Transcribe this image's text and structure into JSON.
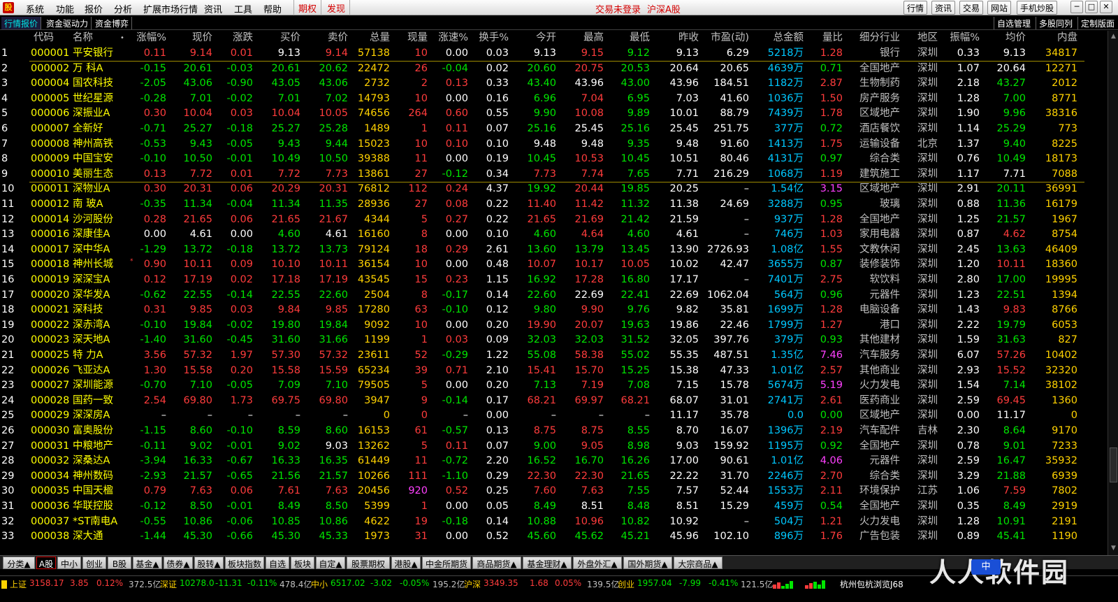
{
  "menubar": {
    "items": [
      "系统",
      "功能",
      "报价",
      "分析",
      "扩展市场行情",
      "资讯",
      "工具",
      "帮助"
    ],
    "red_tabs": [
      "期权",
      "发现"
    ],
    "login_status": "交易未登录",
    "market": "沪深A股",
    "right_buttons": [
      "行情",
      "资讯",
      "交易",
      "网站",
      "手机炒股"
    ]
  },
  "subbar": {
    "tabs": [
      "行情报价",
      "资金驱动力",
      "资金博弈"
    ],
    "right_buttons": [
      "自选管理",
      "多股同列",
      "定制版面"
    ]
  },
  "table": {
    "headers": [
      "代码",
      "名称",
      "涨幅%",
      "现价",
      "涨跌",
      "买价",
      "卖价",
      "总量",
      "现量",
      "涨速%",
      "换手%",
      "今开",
      "最高",
      "最低",
      "昨收",
      "市盈(动)",
      "总金额",
      "量比",
      "细分行业",
      "地区",
      "振幅%",
      "均价",
      "内盘"
    ],
    "rows": [
      [
        "1",
        "000001",
        "平安银行",
        "0.11",
        "9.14",
        "0.01",
        "9.13",
        "9.14",
        "57138",
        "10",
        "0.00",
        "0.03",
        "9.13",
        "9.15",
        "9.12",
        "9.13",
        "6.29",
        "5218万",
        "1.28",
        "银行",
        "深圳",
        "0.33",
        "9.13",
        "34817"
      ],
      [
        "2",
        "000002",
        "万 科A",
        "-0.15",
        "20.61",
        "-0.03",
        "20.61",
        "20.62",
        "22472",
        "26",
        "-0.04",
        "0.02",
        "20.60",
        "20.75",
        "20.53",
        "20.64",
        "20.65",
        "4639万",
        "0.71",
        "全国地产",
        "深圳",
        "1.07",
        "20.64",
        "12271"
      ],
      [
        "3",
        "000004",
        "国农科技",
        "-2.05",
        "43.06",
        "-0.90",
        "43.05",
        "43.06",
        "2732",
        "2",
        "0.13",
        "0.33",
        "43.40",
        "43.96",
        "43.00",
        "43.96",
        "184.51",
        "1182万",
        "2.87",
        "生物制药",
        "深圳",
        "2.18",
        "43.27",
        "2012"
      ],
      [
        "4",
        "000005",
        "世纪星源",
        "-0.28",
        "7.01",
        "-0.02",
        "7.01",
        "7.02",
        "14793",
        "10",
        "0.00",
        "0.16",
        "6.96",
        "7.04",
        "6.95",
        "7.03",
        "41.60",
        "1036万",
        "1.50",
        "房产服务",
        "深圳",
        "1.28",
        "7.00",
        "8771"
      ],
      [
        "5",
        "000006",
        "深振业A",
        "0.30",
        "10.04",
        "0.03",
        "10.04",
        "10.05",
        "74656",
        "264",
        "0.60",
        "0.55",
        "9.90",
        "10.08",
        "9.89",
        "10.01",
        "88.79",
        "7439万",
        "1.78",
        "区域地产",
        "深圳",
        "1.90",
        "9.96",
        "38316"
      ],
      [
        "6",
        "000007",
        "全新好",
        "-0.71",
        "25.27",
        "-0.18",
        "25.27",
        "25.28",
        "1489",
        "1",
        "0.11",
        "0.07",
        "25.16",
        "25.45",
        "25.16",
        "25.45",
        "251.75",
        "377万",
        "0.72",
        "酒店餐饮",
        "深圳",
        "1.14",
        "25.29",
        "773"
      ],
      [
        "7",
        "000008",
        "神州高铁",
        "-0.53",
        "9.43",
        "-0.05",
        "9.43",
        "9.44",
        "15023",
        "10",
        "0.10",
        "0.10",
        "9.48",
        "9.48",
        "9.35",
        "9.48",
        "91.60",
        "1413万",
        "1.75",
        "运输设备",
        "北京",
        "1.37",
        "9.40",
        "8225"
      ],
      [
        "8",
        "000009",
        "中国宝安",
        "-0.10",
        "10.50",
        "-0.01",
        "10.49",
        "10.50",
        "39388",
        "11",
        "0.00",
        "0.19",
        "10.45",
        "10.53",
        "10.45",
        "10.51",
        "80.46",
        "4131万",
        "0.97",
        "综合类",
        "深圳",
        "0.76",
        "10.49",
        "18173"
      ],
      [
        "9",
        "000010",
        "美丽生态",
        "0.13",
        "7.72",
        "0.01",
        "7.72",
        "7.73",
        "13861",
        "27",
        "-0.12",
        "0.34",
        "7.73",
        "7.74",
        "7.65",
        "7.71",
        "216.29",
        "1068万",
        "1.19",
        "建筑施工",
        "深圳",
        "1.17",
        "7.71",
        "7088"
      ],
      [
        "10",
        "000011",
        "深物业A",
        "0.30",
        "20.31",
        "0.06",
        "20.29",
        "20.31",
        "76812",
        "112",
        "0.24",
        "4.37",
        "19.92",
        "20.44",
        "19.85",
        "20.25",
        "–",
        "1.54亿",
        "3.15",
        "区域地产",
        "深圳",
        "2.91",
        "20.11",
        "36991"
      ],
      [
        "11",
        "000012",
        "南 玻A",
        "-0.35",
        "11.34",
        "-0.04",
        "11.34",
        "11.35",
        "28936",
        "27",
        "0.08",
        "0.22",
        "11.40",
        "11.42",
        "11.32",
        "11.38",
        "24.69",
        "3288万",
        "0.95",
        "玻璃",
        "深圳",
        "0.88",
        "11.36",
        "16179"
      ],
      [
        "12",
        "000014",
        "沙河股份",
        "0.28",
        "21.65",
        "0.06",
        "21.65",
        "21.67",
        "4344",
        "5",
        "0.27",
        "0.22",
        "21.65",
        "21.69",
        "21.42",
        "21.59",
        "–",
        "937万",
        "1.28",
        "全国地产",
        "深圳",
        "1.25",
        "21.57",
        "1967"
      ],
      [
        "13",
        "000016",
        "深康佳A",
        "0.00",
        "4.61",
        "0.00",
        "4.60",
        "4.61",
        "16160",
        "8",
        "0.00",
        "0.10",
        "4.60",
        "4.64",
        "4.60",
        "4.61",
        "–",
        "746万",
        "1.03",
        "家用电器",
        "深圳",
        "0.87",
        "4.62",
        "8754"
      ],
      [
        "14",
        "000017",
        "深中华A",
        "-1.29",
        "13.72",
        "-0.18",
        "13.72",
        "13.73",
        "79124",
        "18",
        "0.29",
        "2.61",
        "13.60",
        "13.79",
        "13.45",
        "13.90",
        "2726.93",
        "1.08亿",
        "1.55",
        "文教休闲",
        "深圳",
        "2.45",
        "13.63",
        "46409"
      ],
      [
        "15",
        "000018",
        "神州长城",
        "0.90",
        "10.11",
        "0.09",
        "10.10",
        "10.11",
        "36154",
        "10",
        "0.00",
        "0.48",
        "10.07",
        "10.17",
        "10.05",
        "10.02",
        "42.47",
        "3655万",
        "0.87",
        "装修装饰",
        "深圳",
        "1.20",
        "10.11",
        "18360"
      ],
      [
        "16",
        "000019",
        "深深宝A",
        "0.12",
        "17.19",
        "0.02",
        "17.18",
        "17.19",
        "43545",
        "15",
        "0.23",
        "1.15",
        "16.92",
        "17.28",
        "16.80",
        "17.17",
        "–",
        "7401万",
        "2.75",
        "软饮料",
        "深圳",
        "2.80",
        "17.00",
        "19995"
      ],
      [
        "17",
        "000020",
        "深华发A",
        "-0.62",
        "22.55",
        "-0.14",
        "22.55",
        "22.60",
        "2504",
        "8",
        "-0.17",
        "0.14",
        "22.60",
        "22.69",
        "22.41",
        "22.69",
        "1062.04",
        "564万",
        "0.96",
        "元器件",
        "深圳",
        "1.23",
        "22.51",
        "1394"
      ],
      [
        "18",
        "000021",
        "深科技",
        "0.31",
        "9.85",
        "0.03",
        "9.84",
        "9.85",
        "17280",
        "63",
        "-0.10",
        "0.12",
        "9.80",
        "9.90",
        "9.76",
        "9.82",
        "35.81",
        "1699万",
        "1.28",
        "电脑设备",
        "深圳",
        "1.43",
        "9.83",
        "8766"
      ],
      [
        "19",
        "000022",
        "深赤湾A",
        "-0.10",
        "19.84",
        "-0.02",
        "19.80",
        "19.84",
        "9092",
        "10",
        "0.00",
        "0.20",
        "19.90",
        "20.07",
        "19.63",
        "19.86",
        "22.46",
        "1799万",
        "1.27",
        "港口",
        "深圳",
        "2.22",
        "19.79",
        "6053"
      ],
      [
        "20",
        "000023",
        "深天地A",
        "-1.40",
        "31.60",
        "-0.45",
        "31.60",
        "31.66",
        "1199",
        "1",
        "0.03",
        "0.09",
        "32.03",
        "32.03",
        "31.52",
        "32.05",
        "397.76",
        "379万",
        "0.93",
        "其他建材",
        "深圳",
        "1.59",
        "31.63",
        "827"
      ],
      [
        "21",
        "000025",
        "特 力A",
        "3.56",
        "57.32",
        "1.97",
        "57.30",
        "57.32",
        "23611",
        "52",
        "-0.29",
        "1.22",
        "55.08",
        "58.38",
        "55.02",
        "55.35",
        "487.51",
        "1.35亿",
        "7.46",
        "汽车服务",
        "深圳",
        "6.07",
        "57.26",
        "10402"
      ],
      [
        "22",
        "000026",
        "飞亚达A",
        "1.30",
        "15.58",
        "0.20",
        "15.58",
        "15.59",
        "65234",
        "39",
        "0.71",
        "2.10",
        "15.41",
        "15.70",
        "15.25",
        "15.38",
        "47.33",
        "1.01亿",
        "2.57",
        "其他商业",
        "深圳",
        "2.93",
        "15.52",
        "32320"
      ],
      [
        "23",
        "000027",
        "深圳能源",
        "-0.70",
        "7.10",
        "-0.05",
        "7.09",
        "7.10",
        "79505",
        "5",
        "0.00",
        "0.20",
        "7.13",
        "7.19",
        "7.08",
        "7.15",
        "15.78",
        "5674万",
        "5.19",
        "火力发电",
        "深圳",
        "1.54",
        "7.14",
        "38102"
      ],
      [
        "24",
        "000028",
        "国药一致",
        "2.54",
        "69.80",
        "1.73",
        "69.75",
        "69.80",
        "3947",
        "9",
        "-0.14",
        "0.17",
        "68.21",
        "69.97",
        "68.21",
        "68.07",
        "31.01",
        "2741万",
        "2.61",
        "医药商业",
        "深圳",
        "2.59",
        "69.45",
        "1360"
      ],
      [
        "25",
        "000029",
        "深深房A",
        "–",
        "–",
        "–",
        "–",
        "–",
        "0",
        "0",
        "–",
        "0.00",
        "–",
        "–",
        "–",
        "11.17",
        "35.78",
        "0.0",
        "0.00",
        "区域地产",
        "深圳",
        "0.00",
        "11.17",
        "0"
      ],
      [
        "26",
        "000030",
        "富奥股份",
        "-1.15",
        "8.60",
        "-0.10",
        "8.59",
        "8.60",
        "16153",
        "61",
        "-0.57",
        "0.13",
        "8.75",
        "8.75",
        "8.55",
        "8.70",
        "16.07",
        "1396万",
        "2.19",
        "汽车配件",
        "吉林",
        "2.30",
        "8.64",
        "9170"
      ],
      [
        "27",
        "000031",
        "中粮地产",
        "-0.11",
        "9.02",
        "-0.01",
        "9.02",
        "9.03",
        "13262",
        "5",
        "0.11",
        "0.07",
        "9.00",
        "9.05",
        "8.98",
        "9.03",
        "159.92",
        "1195万",
        "0.92",
        "全国地产",
        "深圳",
        "0.78",
        "9.01",
        "7233"
      ],
      [
        "28",
        "000032",
        "深桑达A",
        "-3.94",
        "16.33",
        "-0.67",
        "16.33",
        "16.35",
        "61449",
        "11",
        "-0.72",
        "2.20",
        "16.52",
        "16.70",
        "16.26",
        "17.00",
        "90.61",
        "1.01亿",
        "4.06",
        "元器件",
        "深圳",
        "2.59",
        "16.47",
        "35932"
      ],
      [
        "29",
        "000034",
        "神州数码",
        "-2.93",
        "21.57",
        "-0.65",
        "21.56",
        "21.57",
        "10266",
        "111",
        "-1.10",
        "0.29",
        "22.30",
        "22.30",
        "21.65",
        "22.22",
        "31.70",
        "2246万",
        "2.70",
        "综合类",
        "深圳",
        "3.29",
        "21.88",
        "6939"
      ],
      [
        "30",
        "000035",
        "中国天楹",
        "0.79",
        "7.63",
        "0.06",
        "7.61",
        "7.63",
        "20456",
        "920",
        "0.52",
        "0.25",
        "7.60",
        "7.63",
        "7.55",
        "7.57",
        "52.44",
        "1553万",
        "2.11",
        "环境保护",
        "江苏",
        "1.06",
        "7.59",
        "7802"
      ],
      [
        "31",
        "000036",
        "华联控股",
        "-0.12",
        "8.50",
        "-0.01",
        "8.49",
        "8.50",
        "5399",
        "1",
        "0.00",
        "0.05",
        "8.49",
        "8.51",
        "8.48",
        "8.51",
        "15.29",
        "459万",
        "0.54",
        "全国地产",
        "深圳",
        "0.35",
        "8.49",
        "2919"
      ],
      [
        "32",
        "000037",
        "*ST南电A",
        "-0.55",
        "10.86",
        "-0.06",
        "10.85",
        "10.86",
        "4622",
        "19",
        "-0.18",
        "0.14",
        "10.88",
        "10.96",
        "10.82",
        "10.92",
        "–",
        "504万",
        "1.21",
        "火力发电",
        "深圳",
        "1.28",
        "10.91",
        "2191"
      ],
      [
        "33",
        "000038",
        "深大通",
        "-1.44",
        "45.30",
        "-0.66",
        "45.30",
        "45.33",
        "1973",
        "31",
        "0.00",
        "0.52",
        "45.60",
        "45.62",
        "45.21",
        "45.96",
        "102.10",
        "896万",
        "1.76",
        "广告包装",
        "深圳",
        "0.89",
        "45.41",
        "1190"
      ]
    ]
  },
  "bottom_tabs": [
    "分类▲",
    "A股",
    "中小",
    "创业",
    "B股",
    "基金▲",
    "债券▲",
    "股转▲",
    "板块指数",
    "自选",
    "板块",
    "自定▲",
    "股票期权",
    "港股▲",
    "中金所期货",
    "商品期货▲",
    "基金理财▲",
    "外盘外汇▲",
    "国外期货▲",
    "大宗商品▲"
  ],
  "ticker": {
    "sh_label": "上证",
    "sh_value": "3158.17",
    "sh_change": "3.85",
    "sh_pct": "0.12%",
    "sh_amount": "372.5亿",
    "sz_label": "深证",
    "sz_value": "10278.0",
    "sz_change": "-11.31",
    "sz_pct": "-0.11%",
    "sz_amount": "478.4亿",
    "zx_label": "中小",
    "zx_value": "6517.02",
    "zx_change": "-3.02",
    "zx_pct": "-0.05%",
    "zx_amount": "195.2亿",
    "hs_label": "沪深",
    "hs_value": "3349.35",
    "hs_change": "1.68",
    "hs_pct": "0.05%",
    "hs_amount": "139.5亿",
    "cy_label": "创业",
    "cy_value": "1957.04",
    "cy_change": "-7.99",
    "cy_pct": "-0.41%",
    "cy_amount": "121.5亿",
    "server": "杭州包杭浏览J68"
  },
  "watermark": {
    "text": "人人软件园",
    "badge": "中"
  },
  "colors": {
    "up": "#ff3c3c",
    "down": "#00e600",
    "flat": "#ffffff",
    "code": "#ffff00",
    "name": "#ffff00",
    "volume": "#ffd200",
    "amount": "#00c8ff",
    "cyan": "#00e5e5",
    "magenta": "#ff40ff",
    "industry": "#c0c0c0",
    "label": "#c0c0c0",
    "header_bg": "#000000"
  }
}
